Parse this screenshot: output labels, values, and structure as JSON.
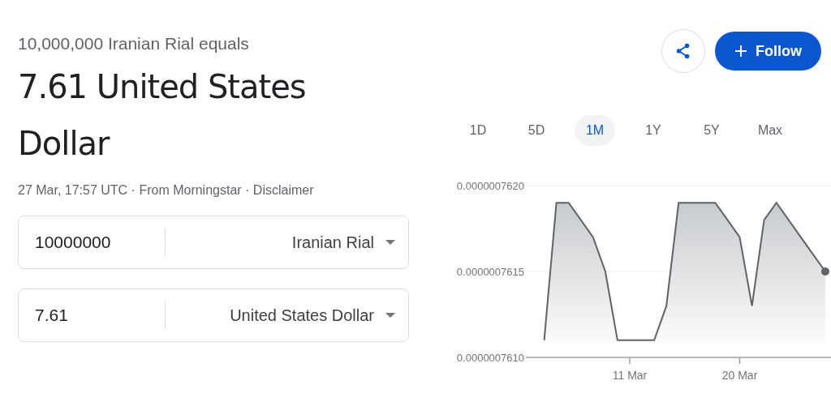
{
  "header": {
    "subtitle": "10,000,000 Iranian Rial equals",
    "result": "7.61 United States Dollar",
    "source": "27 Mar, 17:57 UTC · From Morningstar · Disclaimer"
  },
  "actions": {
    "follow": "Follow"
  },
  "converter": [
    {
      "amount": "10000000",
      "currency": "Iranian Rial"
    },
    {
      "amount": "7.61",
      "currency": "United States Dollar"
    }
  ],
  "ranges": [
    {
      "label": "1D",
      "selected": false
    },
    {
      "label": "5D",
      "selected": false
    },
    {
      "label": "1M",
      "selected": true
    },
    {
      "label": "1Y",
      "selected": false
    },
    {
      "label": "5Y",
      "selected": false
    },
    {
      "label": "Max",
      "selected": false
    }
  ],
  "chart_data": {
    "type": "area",
    "categories": [
      null,
      null,
      null,
      null,
      null,
      null,
      null,
      "11 Mar",
      null,
      null,
      null,
      null,
      null,
      null,
      null,
      null,
      "20 Mar",
      null,
      null,
      null,
      null,
      null,
      null,
      null
    ],
    "series": [
      {
        "color": "#5f6368",
        "values": [
          7.611e-07,
          7.619e-07,
          7.619e-07,
          7.618e-07,
          7.617e-07,
          7.615e-07,
          7.611e-07,
          7.611e-07,
          7.611e-07,
          7.611e-07,
          7.613e-07,
          7.619e-07,
          7.619e-07,
          7.619e-07,
          7.619e-07,
          7.618e-07,
          7.617e-07,
          7.613e-07,
          7.618e-07,
          7.619e-07,
          7.618e-07,
          7.617e-07,
          7.616e-07,
          7.615e-07
        ]
      }
    ],
    "ylim": [
      7.61e-07,
      7.62e-07
    ],
    "yticks": [
      {
        "value": 7.62e-07,
        "label": "0.0000007620"
      },
      {
        "value": 7.615e-07,
        "label": "0.0000007615"
      },
      {
        "value": 7.61e-07,
        "label": "0.0000007610"
      }
    ]
  }
}
